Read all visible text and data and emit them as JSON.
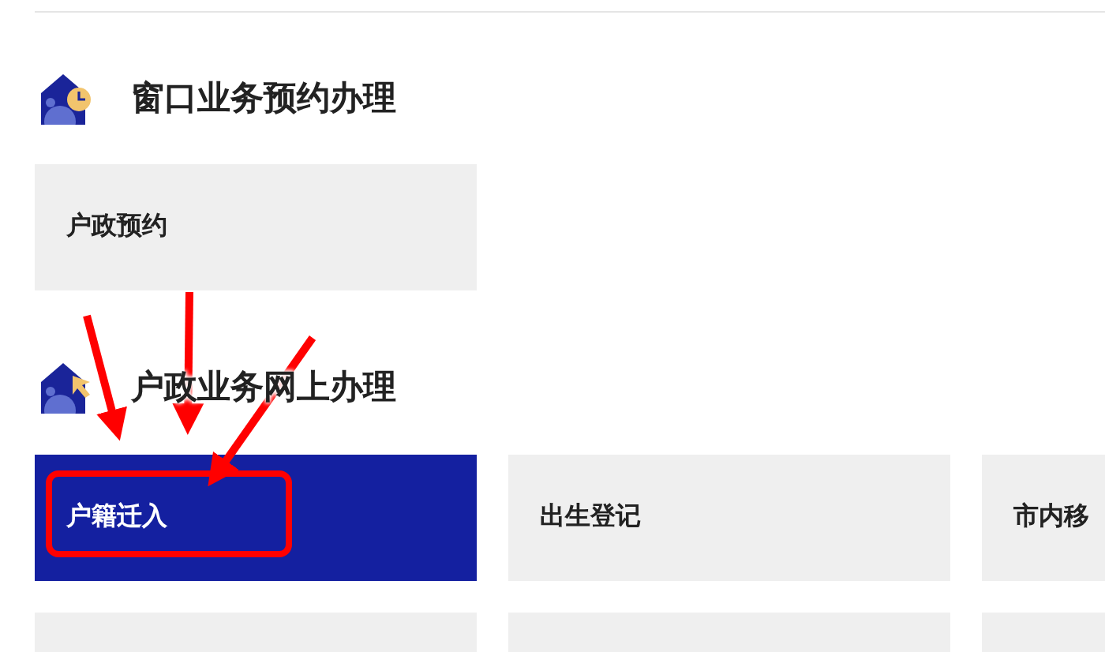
{
  "sections": [
    {
      "title": "窗口业务预约办理",
      "kind": "clock",
      "rows": [
        [
          {
            "label": "户政预约",
            "selected": false
          }
        ]
      ]
    },
    {
      "title": "户政业务网上办理",
      "kind": "cursor",
      "rows": [
        [
          {
            "label": "户籍迁入",
            "selected": true
          },
          {
            "label": "出生登记",
            "selected": false
          },
          {
            "label": "市内移",
            "selected": false
          }
        ],
        [
          {
            "selected": false
          },
          {
            "selected": false
          },
          {
            "selected": false
          }
        ]
      ]
    }
  ],
  "annotation": {
    "kind": "arrows"
  }
}
